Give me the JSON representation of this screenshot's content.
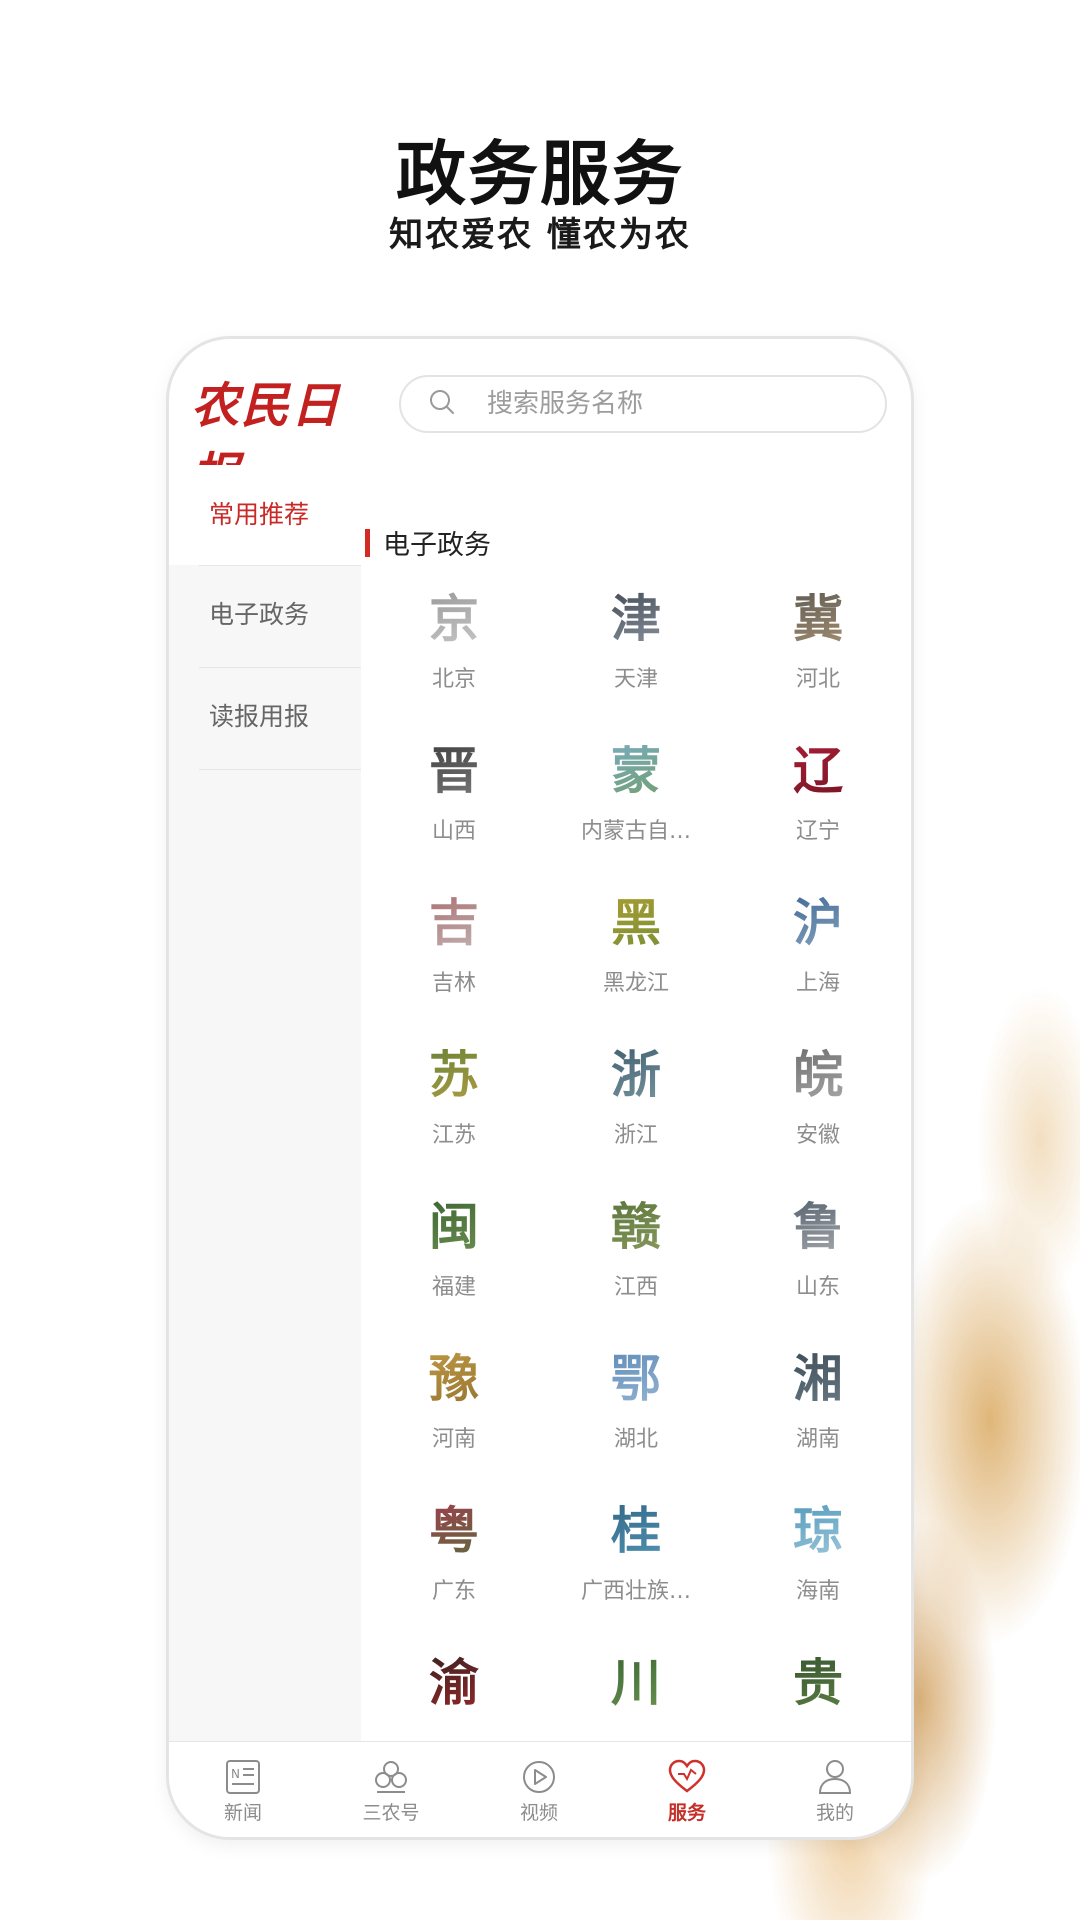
{
  "header": {
    "title": "政务服务",
    "subtitle": "知农爱农  懂农为农"
  },
  "app": {
    "logo_text": "农民日报",
    "search_placeholder": "搜索服务名称",
    "accent_color": "#c82b27"
  },
  "sidebar": {
    "items": [
      {
        "label": "常用推荐",
        "active": true
      },
      {
        "label": "电子政务",
        "active": false
      },
      {
        "label": "读报用报",
        "active": false
      }
    ]
  },
  "section": {
    "title": "电子政务"
  },
  "provinces": [
    {
      "glyph": "京",
      "name": "北京",
      "colors": [
        "#8b8b8b",
        "#d6d6d6"
      ]
    },
    {
      "glyph": "津",
      "name": "天津",
      "colors": [
        "#2f3640",
        "#a0a9b5"
      ]
    },
    {
      "glyph": "冀",
      "name": "河北",
      "colors": [
        "#4a4a4a",
        "#b9a07a"
      ]
    },
    {
      "glyph": "晋",
      "name": "山西",
      "colors": [
        "#2d2d2d",
        "#8c8c8c"
      ]
    },
    {
      "glyph": "蒙",
      "name": "内蒙古自…",
      "colors": [
        "#7bb0d6",
        "#6f9a57"
      ]
    },
    {
      "glyph": "辽",
      "name": "辽宁",
      "colors": [
        "#b5213a",
        "#6b1222"
      ]
    },
    {
      "glyph": "吉",
      "name": "吉林",
      "colors": [
        "#a35a5a",
        "#c9c9c9"
      ]
    },
    {
      "glyph": "黑",
      "name": "黑龙江",
      "colors": [
        "#b7a12d",
        "#6c8a3a"
      ]
    },
    {
      "glyph": "沪",
      "name": "上海",
      "colors": [
        "#2c5a8a",
        "#9fb6cc"
      ]
    },
    {
      "glyph": "苏",
      "name": "江苏",
      "colors": [
        "#4f7a2f",
        "#c9a64a"
      ]
    },
    {
      "glyph": "浙",
      "name": "浙江",
      "colors": [
        "#2f5060",
        "#8aa5b0"
      ]
    },
    {
      "glyph": "皖",
      "name": "安徽",
      "colors": [
        "#5a5a5a",
        "#bcbcbc"
      ]
    },
    {
      "glyph": "闽",
      "name": "福建",
      "colors": [
        "#2f5a2a",
        "#7b9a5a"
      ]
    },
    {
      "glyph": "赣",
      "name": "江西",
      "colors": [
        "#4a6a2f",
        "#9aa56a"
      ]
    },
    {
      "glyph": "鲁",
      "name": "山东",
      "colors": [
        "#3a4a5a",
        "#c2c2c2"
      ]
    },
    {
      "glyph": "豫",
      "name": "河南",
      "colors": [
        "#c9a24a",
        "#8a6a2a"
      ]
    },
    {
      "glyph": "鄂",
      "name": "湖北",
      "colors": [
        "#4f7fb0",
        "#a8c3dc"
      ]
    },
    {
      "glyph": "湘",
      "name": "湖南",
      "colors": [
        "#2f3f4a",
        "#7a8a94"
      ]
    },
    {
      "glyph": "粤",
      "name": "广东",
      "colors": [
        "#b03050",
        "#4a7a3a"
      ]
    },
    {
      "glyph": "桂",
      "name": "广西壮族…",
      "colors": [
        "#2a5a7a",
        "#5aa0c0"
      ]
    },
    {
      "glyph": "琼",
      "name": "海南",
      "colors": [
        "#3a8ab0",
        "#b8d8e6"
      ]
    },
    {
      "glyph": "渝",
      "name": "",
      "colors": [
        "#1f1f1f",
        "#b22a2a"
      ]
    },
    {
      "glyph": "川",
      "name": "",
      "colors": [
        "#2a5a2a",
        "#7aa05a"
      ]
    },
    {
      "glyph": "贵",
      "name": "",
      "colors": [
        "#2a4a2a",
        "#6a8a4a"
      ]
    }
  ],
  "tabbar": {
    "items": [
      {
        "label": "新闻",
        "icon": "newspaper-icon",
        "active": false
      },
      {
        "label": "三农号",
        "icon": "clover-icon",
        "active": false
      },
      {
        "label": "视频",
        "icon": "play-icon",
        "active": false
      },
      {
        "label": "服务",
        "icon": "heart-icon",
        "active": true
      },
      {
        "label": "我的",
        "icon": "user-icon",
        "active": false
      }
    ]
  }
}
